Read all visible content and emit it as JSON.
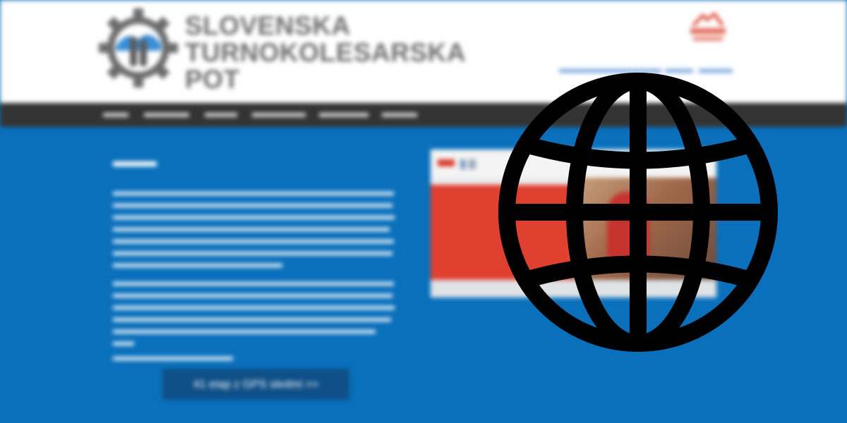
{
  "header": {
    "logo_icon": "gear-cyclist-icon",
    "title_lines": [
      "SLOVENSKA",
      "TURNOKOLESARSKA",
      "POT"
    ],
    "partner_logo_text": "",
    "header_link_text": ""
  },
  "nav": {
    "items": [
      "",
      "",
      "",
      "",
      "",
      ""
    ]
  },
  "content": {
    "heading": "",
    "paragraphs": [
      "",
      "",
      ""
    ]
  },
  "cta": {
    "label": "41 etap z GPS sledmi >>"
  },
  "banner": {
    "brand": ""
  },
  "overlay": {
    "icon": "globe-icon"
  },
  "colors": {
    "header_bg": "#ffffff",
    "nav_bg": "#333333",
    "content_bg": "#0a70bb",
    "button_bg": "#0e4f87",
    "title_gray": "#6d6d6d",
    "accent_red": "#d9442e",
    "globe": "#000000"
  }
}
